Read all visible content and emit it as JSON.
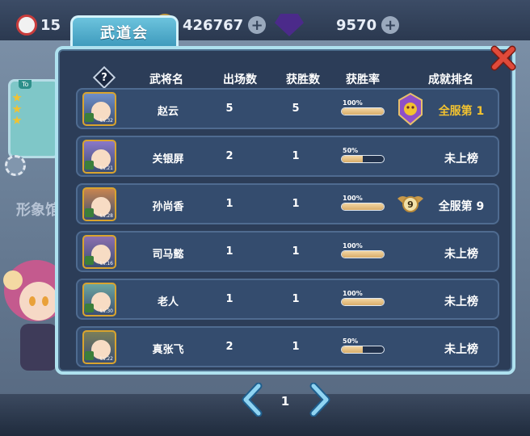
{
  "top_resources": [
    {
      "value": "15",
      "icon": "dice-icon"
    },
    {
      "value": "426767",
      "icon": "gold-coin-icon"
    },
    {
      "value": "9570",
      "icon": "purple-gem-icon"
    }
  ],
  "background": {
    "side_label": "形象馆"
  },
  "dialog": {
    "title": "武道会",
    "columns": [
      "武将名",
      "出场数",
      "获胜数",
      "获胜率",
      "成就排名"
    ],
    "help_symbol": "?",
    "rows": [
      {
        "name": "赵云",
        "appearances": "5",
        "wins": "5",
        "win_rate_text": "100%",
        "win_rate": 1.0,
        "rank": "全服第 1",
        "rank_icon": "dragon-crest-icon",
        "avatar_color": "#6f8fc9",
        "level": "Lv.32"
      },
      {
        "name": "关银屏",
        "appearances": "2",
        "wins": "1",
        "win_rate_text": "50%",
        "win_rate": 0.5,
        "rank": "未上榜",
        "rank_icon": "",
        "avatar_color": "#8a78c8",
        "level": "Lv.21"
      },
      {
        "name": "孙尚香",
        "appearances": "1",
        "wins": "1",
        "win_rate_text": "100%",
        "win_rate": 1.0,
        "rank": "全服第 9",
        "rank_icon": "winged-rank-9-icon",
        "avatar_color": "#c9854e",
        "level": "Lv.28"
      },
      {
        "name": "司马懿",
        "appearances": "1",
        "wins": "1",
        "win_rate_text": "100%",
        "win_rate": 1.0,
        "rank": "未上榜",
        "rank_icon": "",
        "avatar_color": "#8c6fb0",
        "level": "Lv.16"
      },
      {
        "name": "老人",
        "appearances": "1",
        "wins": "1",
        "win_rate_text": "100%",
        "win_rate": 1.0,
        "rank": "未上榜",
        "rank_icon": "",
        "avatar_color": "#6ca6a0",
        "level": "Lv.30"
      },
      {
        "name": "真张飞",
        "appearances": "2",
        "wins": "1",
        "win_rate_text": "50%",
        "win_rate": 0.5,
        "rank": "未上榜",
        "rank_icon": "",
        "avatar_color": "#7a7f5a",
        "level": "Lv.22"
      }
    ]
  },
  "pager": {
    "page": "1"
  },
  "colors": {
    "gold": "#f2c230",
    "dialog_bg": "#2c3d58",
    "row_bg": "#344c6e",
    "close_red": "#e04a3a"
  }
}
